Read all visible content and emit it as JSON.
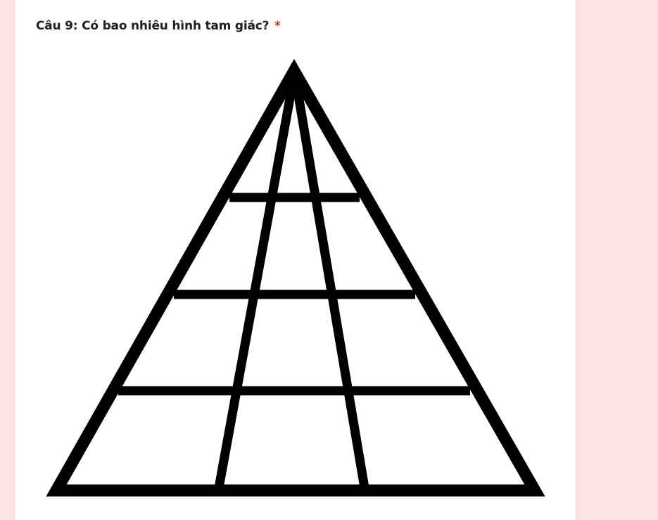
{
  "question": {
    "title": "Câu 9: Có bao nhiêu hình tam giác?",
    "required_marker": "*",
    "required_color": "#d93025"
  },
  "colors": {
    "page_background": "#fde4e4",
    "card_background": "#ffffff",
    "figure_stroke": "#000000"
  }
}
